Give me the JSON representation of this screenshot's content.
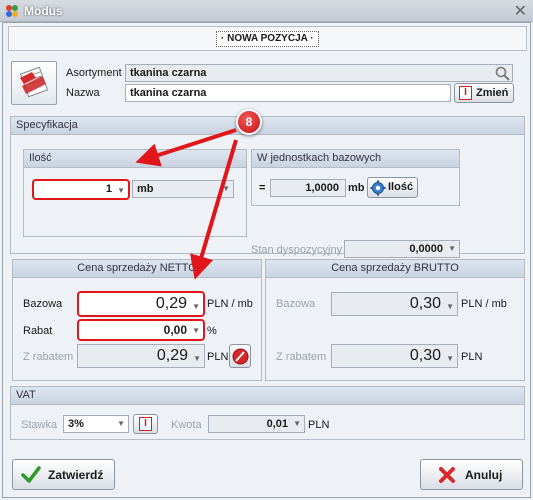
{
  "window": {
    "title": "Modus"
  },
  "header": {
    "title": "· NOWA POZYCJA ·"
  },
  "product": {
    "asortyment_label": "Asortyment",
    "asortyment_value": "tkanina czarna",
    "nazwa_label": "Nazwa",
    "nazwa_value": "tkanina czarna",
    "change_button": "Zmień"
  },
  "spec": {
    "title": "Specyfikacja",
    "ilosc": {
      "title": "Ilość",
      "value": "1",
      "unit": "mb"
    },
    "base_units": {
      "title": "W jednostkach bazowych",
      "equals": "=",
      "value": "1,0000",
      "unit": "mb",
      "button": "Ilość",
      "stan_label": "Stan dyspozycyjny",
      "stan_value": "0,0000"
    }
  },
  "netto": {
    "title": "Cena sprzedaży NETTO",
    "bazowa_label": "Bazowa",
    "bazowa_value": "0,29",
    "bazowa_unit": "PLN / mb",
    "rabat_label": "Rabat",
    "rabat_value": "0,00",
    "rabat_unit": "%",
    "zrabatem_label": "Z rabatem",
    "zrabatem_value": "0,29",
    "zrabatem_unit": "PLN"
  },
  "brutto": {
    "title": "Cena sprzedaży BRUTTO",
    "bazowa_label": "Bazowa",
    "bazowa_value": "0,30",
    "bazowa_unit": "PLN / mb",
    "zrabatem_label": "Z rabatem",
    "zrabatem_value": "0,30",
    "zrabatem_unit": "PLN"
  },
  "vat": {
    "title": "VAT",
    "stawka_label": "Stawka",
    "stawka_value": "3%",
    "kwota_label": "Kwota",
    "kwota_value": "0,01",
    "kwota_unit": "PLN"
  },
  "footer": {
    "confirm": "Zatwierdź",
    "cancel": "Anuluj"
  },
  "annotation": {
    "badge": "8",
    "color": "#e0161b"
  },
  "icons": {
    "search": "search-icon",
    "edit": "text-cursor-icon",
    "gear": "gear-icon",
    "calc": "calculator-icon",
    "confirm": "checkmark-icon",
    "cancel": "cross-icon",
    "document": "document-icon"
  }
}
